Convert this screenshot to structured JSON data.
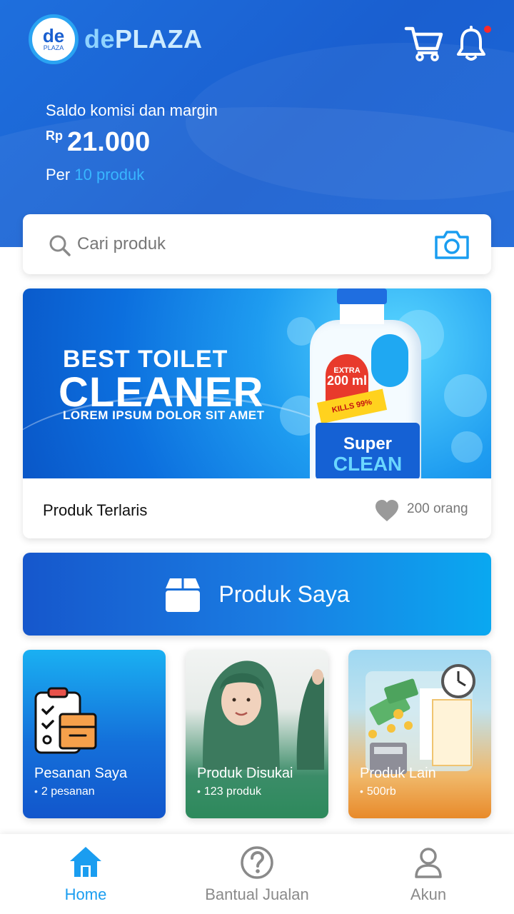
{
  "app": {
    "logo_mark": "de",
    "logo_mark_sub": "PLAZA",
    "logo_prefix": "de",
    "logo_suffix": "PLAZA"
  },
  "header": {
    "icons": [
      "cart-icon",
      "bell-icon"
    ],
    "has_notification": true,
    "balance_label": "Saldo komisi dan margin",
    "currency": "Rp",
    "balance_value": "21.000",
    "per_prefix": "Per",
    "per_count": "10 produk"
  },
  "search": {
    "placeholder": "Cari produk",
    "icons": [
      "search-icon",
      "camera-icon"
    ]
  },
  "promo": {
    "banner_line1": "BEST TOILET",
    "banner_line2": "CLEANER",
    "banner_sub": "LOREM IPSUM DOLOR SIT AMET",
    "bottle_extra": "EXTRA",
    "bottle_volume": "200 ml",
    "bottle_kills": "KILLS 99%",
    "bottle_brand1": "Super",
    "bottle_brand2": "CLEAN",
    "footer_title": "Produk Terlaris",
    "likes": "200 orang"
  },
  "my_products": {
    "label": "Produk Saya",
    "icon": "box-icon"
  },
  "tiles": [
    {
      "title": "Pesanan Saya",
      "sub": "2 pesanan"
    },
    {
      "title": "Produk Disukai",
      "sub": "123 produk"
    },
    {
      "title": "Produk Lain",
      "sub": "500rb"
    }
  ],
  "bottom_nav": {
    "items": [
      {
        "label": "Home",
        "icon": "home-icon",
        "active": true
      },
      {
        "label": "Bantual Jualan",
        "icon": "help-icon",
        "active": false
      },
      {
        "label": "Akun",
        "icon": "user-icon",
        "active": false
      }
    ],
    "active_color": "#1a9df0"
  },
  "colors": {
    "header_blue": "#1e6fdd",
    "accent_blue": "#1a9df0",
    "notification": "#ff2a2a"
  }
}
